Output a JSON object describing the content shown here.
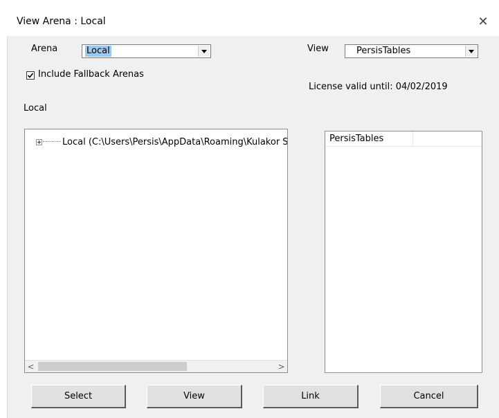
{
  "window": {
    "title": "View Arena : Local",
    "close_glyph": "✕"
  },
  "arena": {
    "label": "Arena",
    "value": "Local"
  },
  "include_fallback": {
    "label": "Include Fallback Arenas",
    "checked": true
  },
  "view": {
    "label": "View",
    "value": "PersisTables"
  },
  "license": {
    "text": "License valid until: 04/02/2019"
  },
  "tree": {
    "label": "Local",
    "items": [
      {
        "label": "Local (C:\\Users\\Persis\\AppData\\Roaming\\Kulakor S",
        "expanded": false
      }
    ]
  },
  "list": {
    "columns": [
      "PersisTables",
      ""
    ]
  },
  "scroll": {
    "left_glyph": "<",
    "right_glyph": ">"
  },
  "buttons": {
    "select": "Select",
    "view": "View",
    "link": "Link",
    "cancel": "Cancel"
  },
  "colors": {
    "selection": "#99c9ef",
    "dialog_bg": "#f0f0f0",
    "button_bg": "#e1e1e1"
  }
}
